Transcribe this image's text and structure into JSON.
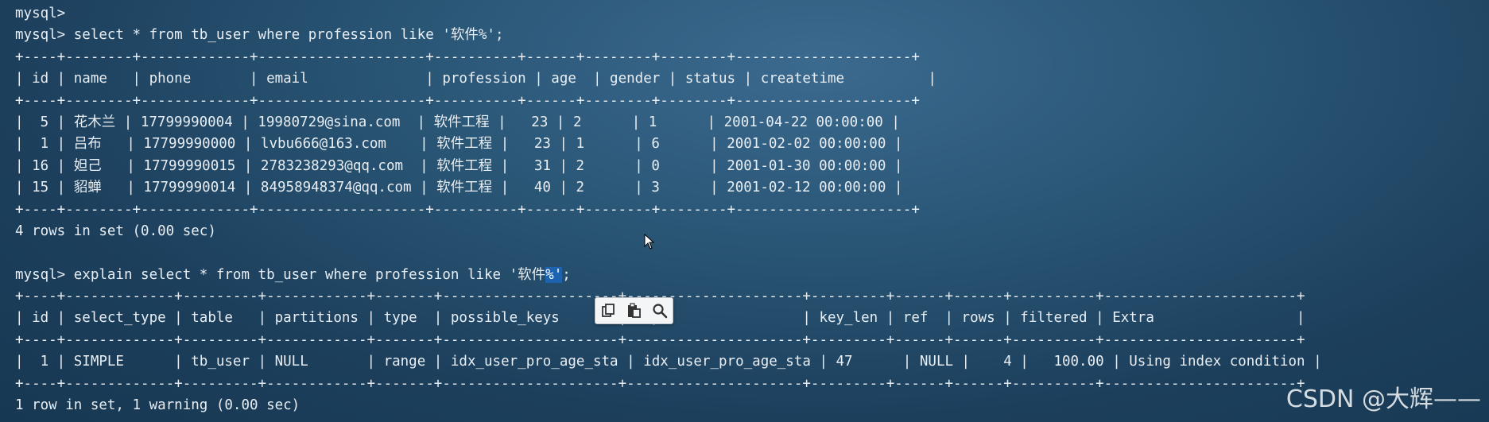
{
  "terminal": {
    "lines": [
      {
        "id": "l0",
        "text": "mysql>"
      },
      {
        "id": "l1",
        "text": "mysql> select * from tb_user where profession like '软件%';"
      },
      {
        "id": "l2",
        "text": "+----+--------+-------------+--------------------+----------+------+--------+--------+---------------------+"
      },
      {
        "id": "l3",
        "text": "| id | name   | phone       | email              | profession | age  | gender | status | createtime          |"
      },
      {
        "id": "l4",
        "text": "+----+--------+-------------+--------------------+----------+------+--------+--------+---------------------+"
      },
      {
        "id": "l5",
        "text": "|  5 | 花木兰 | 17799990004 | 19980729@sina.com  | 软件工程 |   23 | 2      | 1      | 2001-04-22 00:00:00 |"
      },
      {
        "id": "l6",
        "text": "|  1 | 吕布   | 17799990000 | lvbu666@163.com    | 软件工程 |   23 | 1      | 6      | 2001-02-02 00:00:00 |"
      },
      {
        "id": "l7",
        "text": "| 16 | 妲己   | 17799990015 | 2783238293@qq.com  | 软件工程 |   31 | 2      | 0      | 2001-01-30 00:00:00 |"
      },
      {
        "id": "l8",
        "text": "| 15 | 貂蝉   | 17799990014 | 84958948374@qq.com | 软件工程 |   40 | 2      | 3      | 2001-02-12 00:00:00 |"
      },
      {
        "id": "l9",
        "text": "+----+--------+-------------+--------------------+----------+------+--------+--------+---------------------+"
      },
      {
        "id": "l10",
        "text": "4 rows in set (0.00 sec)"
      },
      {
        "id": "l11",
        "text": ""
      },
      {
        "id": "l12",
        "text": "mysql> explain select * from tb_user where profession like '软件",
        "highlight": "%'",
        "tail": ";"
      },
      {
        "id": "l13",
        "text": "+----+-------------+---------+------------+-------+---------------------+---------------------+---------+------+------+----------+-----------------------+"
      },
      {
        "id": "l14",
        "text": "| id | select_type | table   | partitions | type  | possible_keys       | key                 | key_len | ref  | rows | filtered | Extra                 |"
      },
      {
        "id": "l15",
        "text": "+----+-------------+---------+------------+-------+---------------------+---------------------+---------+------+------+----------+-----------------------+"
      },
      {
        "id": "l16",
        "text": "|  1 | SIMPLE      | tb_user | NULL       | range | idx_user_pro_age_sta | idx_user_pro_age_sta | 47      | NULL |    4 |   100.00 | Using index condition |"
      },
      {
        "id": "l17",
        "text": "+----+-------------+---------+------------+-------+---------------------+---------------------+---------+------+------+----------+-----------------------+"
      },
      {
        "id": "l18",
        "text": "1 row in set, 1 warning (0.00 sec)"
      }
    ]
  },
  "popup": {
    "buttons": [
      {
        "name": "copy-icon"
      },
      {
        "name": "paste-icon"
      },
      {
        "name": "search-icon"
      }
    ]
  },
  "watermark": {
    "text": "CSDN @大辉——"
  },
  "colors": {
    "text": "#e8eef3",
    "highlight": "#1e63b0",
    "background": "#2a5676"
  }
}
